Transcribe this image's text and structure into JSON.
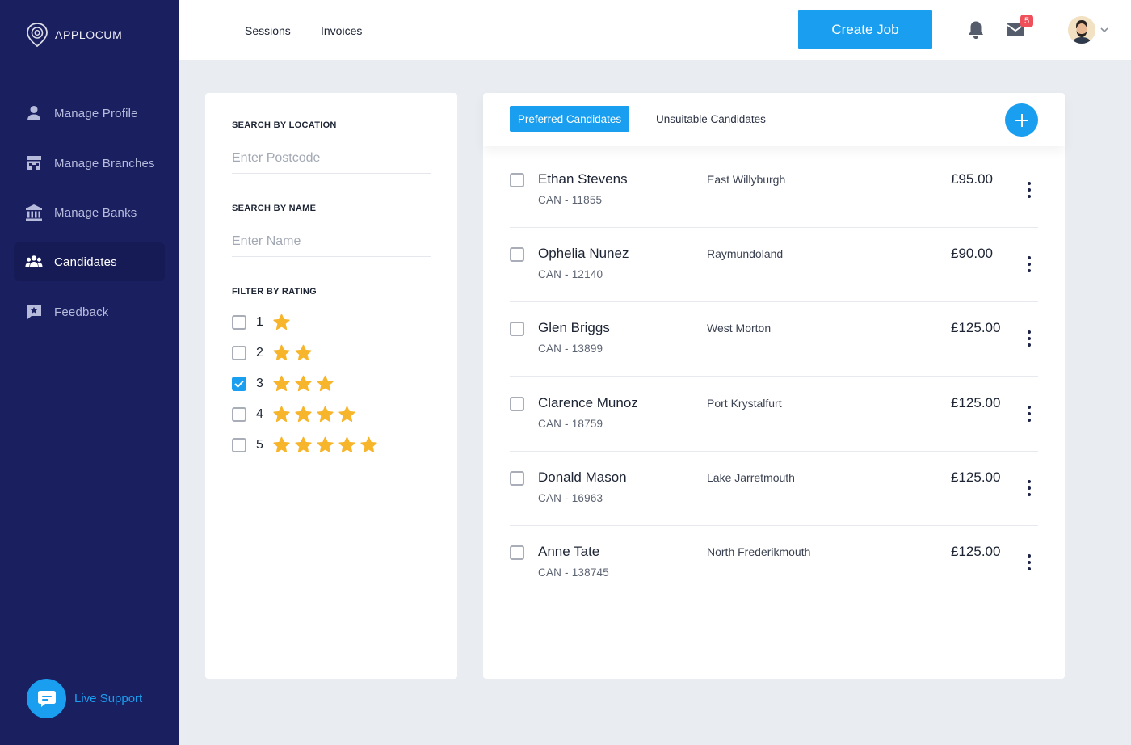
{
  "app": {
    "logo_text": "APPLOCUM"
  },
  "sidebar": {
    "items": [
      {
        "label": "Manage Profile",
        "icon": "user-icon"
      },
      {
        "label": "Manage Branches",
        "icon": "store-icon"
      },
      {
        "label": "Manage Banks",
        "icon": "bank-icon"
      },
      {
        "label": "Candidates",
        "icon": "users-icon",
        "active": true
      },
      {
        "label": "Feedback",
        "icon": "feedback-icon"
      }
    ],
    "support_label": "Live Support"
  },
  "topbar": {
    "links": [
      "Sessions",
      "Invoices"
    ],
    "create_job_label": "Create Job",
    "mail_badge": "5"
  },
  "filter": {
    "location_heading": "SEARCH BY LOCATION",
    "location_placeholder": "Enter Postcode",
    "name_heading": "SEARCH BY NAME",
    "name_placeholder": "Enter Name",
    "rating_heading": "FILTER BY RATING",
    "ratings": [
      {
        "value": "1",
        "stars": 1,
        "checked": false
      },
      {
        "value": "2",
        "stars": 2,
        "checked": false
      },
      {
        "value": "3",
        "stars": 3,
        "checked": true
      },
      {
        "value": "4",
        "stars": 4,
        "checked": false
      },
      {
        "value": "5",
        "stars": 5,
        "checked": false
      }
    ]
  },
  "candidates": {
    "tabs": [
      "Preferred Candidates",
      "Unsuitable Candidates"
    ],
    "active_tab": 0,
    "rows": [
      {
        "name": "Ethan Stevens",
        "id": "CAN - 11855",
        "location": "East Willyburgh",
        "rate": "£95.00"
      },
      {
        "name": "Ophelia Nunez",
        "id": "CAN - 12140",
        "location": "Raymundoland",
        "rate": "£90.00"
      },
      {
        "name": "Glen Briggs",
        "id": "CAN - 13899",
        "location": "West Morton",
        "rate": "£125.00"
      },
      {
        "name": "Clarence Munoz",
        "id": "CAN - 18759",
        "location": "Port Krystalfurt",
        "rate": "£125.00"
      },
      {
        "name": "Donald Mason",
        "id": "CAN - 16963",
        "location": "Lake Jarretmouth",
        "rate": "£125.00"
      },
      {
        "name": "Anne Tate",
        "id": "CAN - 138745",
        "location": "North Frederikmouth",
        "rate": "£125.00"
      }
    ]
  },
  "colors": {
    "sidebar": "#1a1f60",
    "accent": "#1a9ff0",
    "star": "#f7b52c",
    "badge": "#f0505a"
  }
}
